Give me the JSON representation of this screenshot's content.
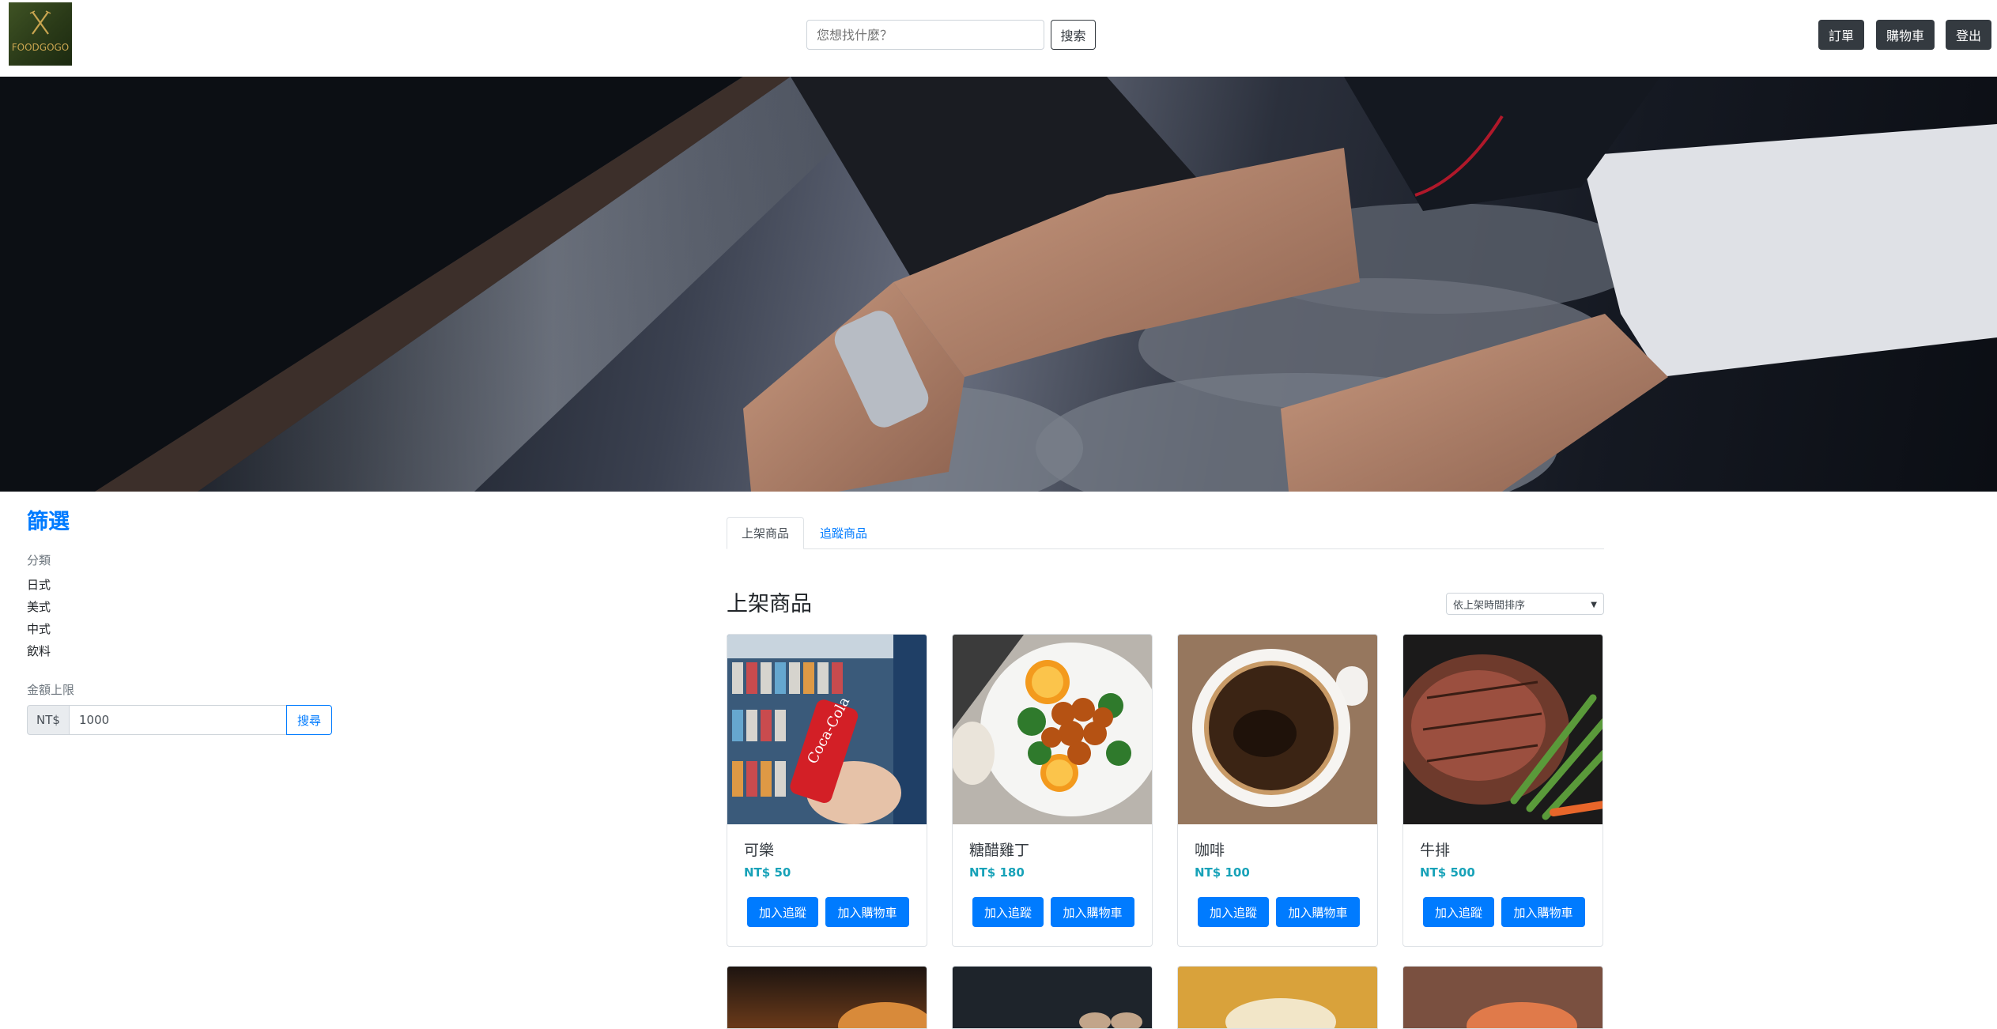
{
  "header": {
    "logo_text": "FOODGOGO",
    "search": {
      "placeholder": "您想找什麼？"
    },
    "search_button": "搜索",
    "nav": {
      "orders": "訂單",
      "cart": "購物車",
      "logout": "登出"
    }
  },
  "sidebar": {
    "title": "篩選",
    "category_label": "分類",
    "categories": [
      "日式",
      "美式",
      "中式",
      "飲料"
    ],
    "price_label": "金額上限",
    "currency_prefix": "NT$",
    "price_value": "1000",
    "price_button": "搜尋"
  },
  "main": {
    "tabs": [
      {
        "label": "上架商品",
        "active": true
      },
      {
        "label": "追蹤商品",
        "active": false
      }
    ],
    "section_title": "上架商品",
    "sort": {
      "selected": "依上架時間排序"
    },
    "products": [
      {
        "name": "可樂",
        "price": "NT$ 50",
        "follow": "加入追蹤",
        "add_cart": "加入購物車"
      },
      {
        "name": "糖醋雞丁",
        "price": "NT$ 180",
        "follow": "加入追蹤",
        "add_cart": "加入購物車"
      },
      {
        "name": "咖啡",
        "price": "NT$ 100",
        "follow": "加入追蹤",
        "add_cart": "加入購物車"
      },
      {
        "name": "牛排",
        "price": "NT$ 500",
        "follow": "加入追蹤",
        "add_cart": "加入購物車"
      }
    ]
  },
  "colors": {
    "primary": "#007bff",
    "dark": "#343a40",
    "price": "#17a2b8"
  }
}
